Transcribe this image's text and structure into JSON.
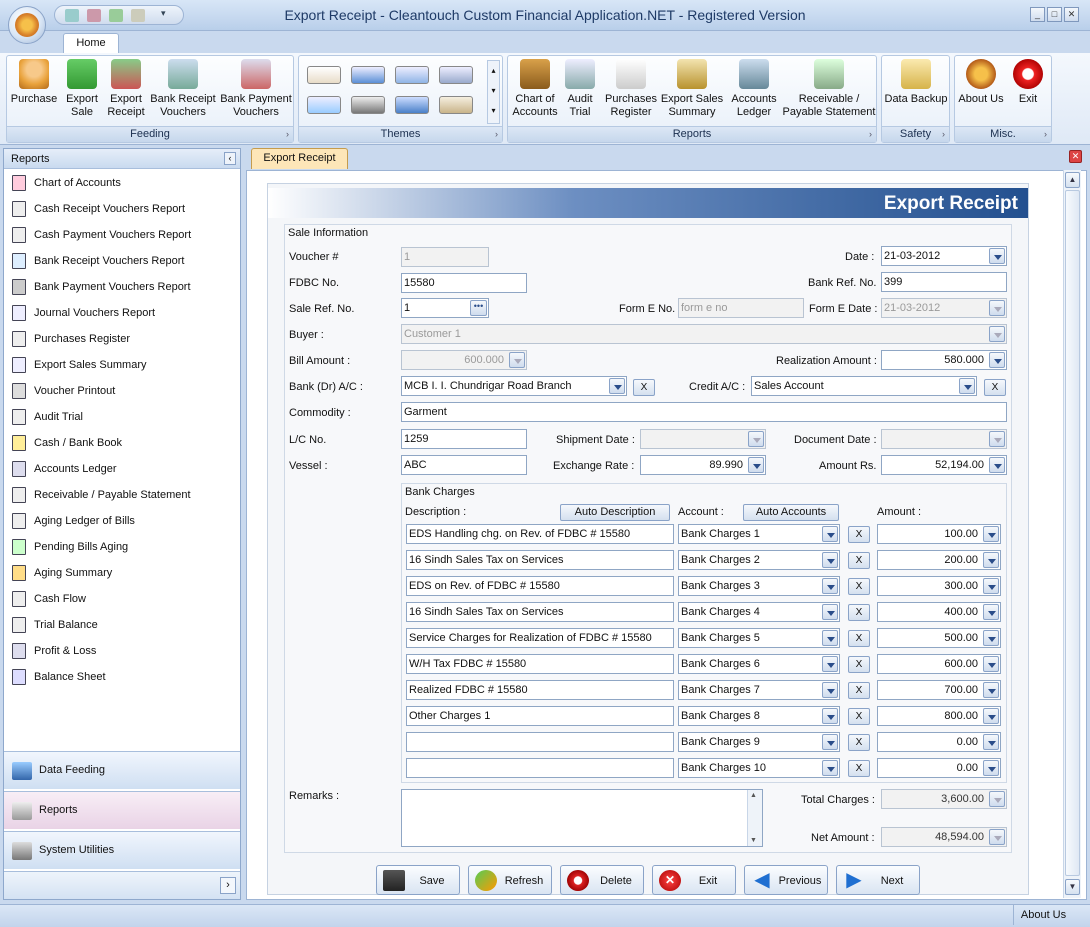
{
  "window": {
    "title": "Export Receipt - Cleantouch Custom Financial Application.NET - Registered Version"
  },
  "ribbon": {
    "tab": "Home",
    "groups": {
      "feeding": {
        "label": "Feeding",
        "buttons": [
          "Purchase",
          "Export Sale",
          "Export Receipt",
          "Bank Receipt Vouchers",
          "Bank Payment Vouchers"
        ]
      },
      "themes": {
        "label": "Themes"
      },
      "reports": {
        "label": "Reports",
        "buttons": [
          "Chart of Accounts",
          "Audit Trial",
          "Purchases Register",
          "Export Sales Summary",
          "Accounts Ledger",
          "Receivable / Payable Statement"
        ]
      },
      "safety": {
        "label": "Safety",
        "buttons": [
          "Data Backup"
        ]
      },
      "misc": {
        "label": "Misc.",
        "buttons": [
          "About Us",
          "Exit"
        ]
      }
    }
  },
  "left_panel": {
    "title": "Reports",
    "items": [
      "Chart of Accounts",
      "Cash Receipt Vouchers Report",
      "Cash Payment Vouchers Report",
      "Bank Receipt Vouchers Report",
      "Bank Payment Vouchers Report",
      "Journal Vouchers Report",
      "Purchases Register",
      "Export Sales Summary",
      "Voucher Printout",
      "Audit Trial",
      "Cash / Bank Book",
      "Accounts Ledger",
      "Receivable / Payable Statement",
      "Aging Ledger of Bills",
      "Pending Bills Aging",
      "Aging Summary",
      "Cash Flow",
      "Trial Balance",
      "Profit & Loss",
      "Balance Sheet"
    ],
    "nav": [
      "Data Feeding",
      "Reports",
      "System Utilities"
    ]
  },
  "document": {
    "tab": "Export Receipt",
    "header": "Export Receipt",
    "sale_info": {
      "legend": "Sale Information",
      "voucher_label": "Voucher #",
      "voucher": "1",
      "date_label": "Date :",
      "date": "21-03-2012",
      "fdbc_label": "FDBC No.",
      "fdbc": "15580",
      "bank_ref_label": "Bank Ref. No.",
      "bank_ref": "399",
      "sale_ref_label": "Sale Ref. No.",
      "sale_ref": "1",
      "form_e_label": "Form E No.",
      "form_e_placeholder": "form e no",
      "form_e_date_label": "Form E Date :",
      "form_e_date": "21-03-2012",
      "buyer_label": "Buyer :",
      "buyer": "Customer 1",
      "bill_amount_label": "Bill Amount :",
      "bill_amount": "600.000",
      "realization_label": "Realization Amount :",
      "realization": "580.000",
      "bank_label": "Bank (Dr) A/C :",
      "bank": "MCB I. I. Chundrigar Road Branch",
      "credit_label": "Credit A/C :",
      "credit": "Sales Account",
      "commodity_label": "Commodity :",
      "commodity": "Garment",
      "lc_label": "L/C No.",
      "lc": "1259",
      "shipment_label": "Shipment Date :",
      "document_date_label": "Document Date :",
      "vessel_label": "Vessel :",
      "vessel": "ABC",
      "exchange_label": "Exchange Rate :",
      "exchange": "89.990",
      "amount_rs_label": "Amount Rs.",
      "amount_rs": "52,194.00"
    },
    "bank_charges": {
      "legend": "Bank Charges",
      "desc_label": "Description :",
      "auto_desc": "Auto Description",
      "account_label": "Account :",
      "auto_accounts": "Auto Accounts",
      "amount_label": "Amount :",
      "rows": [
        {
          "desc": "EDS Handling chg. on Rev. of FDBC # 15580",
          "account": "Bank Charges 1",
          "amount": "100.00"
        },
        {
          "desc": "16 Sindh Sales Tax on Services",
          "account": "Bank Charges 2",
          "amount": "200.00"
        },
        {
          "desc": "EDS on Rev. of FDBC # 15580",
          "account": "Bank Charges 3",
          "amount": "300.00"
        },
        {
          "desc": "16 Sindh Sales Tax on Services",
          "account": "Bank Charges 4",
          "amount": "400.00"
        },
        {
          "desc": "Service Charges for Realization of FDBC # 15580",
          "account": "Bank Charges 5",
          "amount": "500.00"
        },
        {
          "desc": "W/H Tax FDBC # 15580",
          "account": "Bank Charges 6",
          "amount": "600.00"
        },
        {
          "desc": "Realized FDBC # 15580",
          "account": "Bank Charges 7",
          "amount": "700.00"
        },
        {
          "desc": "Other Charges 1",
          "account": "Bank Charges 8",
          "amount": "800.00"
        },
        {
          "desc": "",
          "account": "Bank Charges 9",
          "amount": "0.00"
        },
        {
          "desc": "",
          "account": "Bank Charges 10",
          "amount": "0.00"
        }
      ],
      "x_label": "X"
    },
    "remarks_label": "Remarks :",
    "total_charges_label": "Total Charges :",
    "total_charges": "3,600.00",
    "net_amount_label": "Net Amount :",
    "net_amount": "48,594.00",
    "actions": [
      "Save",
      "Refresh",
      "Delete",
      "Exit",
      "Previous",
      "Next"
    ]
  },
  "status_bar": {
    "about": "About Us"
  },
  "colors": {
    "header_dark": "#23508f",
    "ribbon_bg": "#dfe9f6",
    "tab_active": "#fde6b8"
  }
}
